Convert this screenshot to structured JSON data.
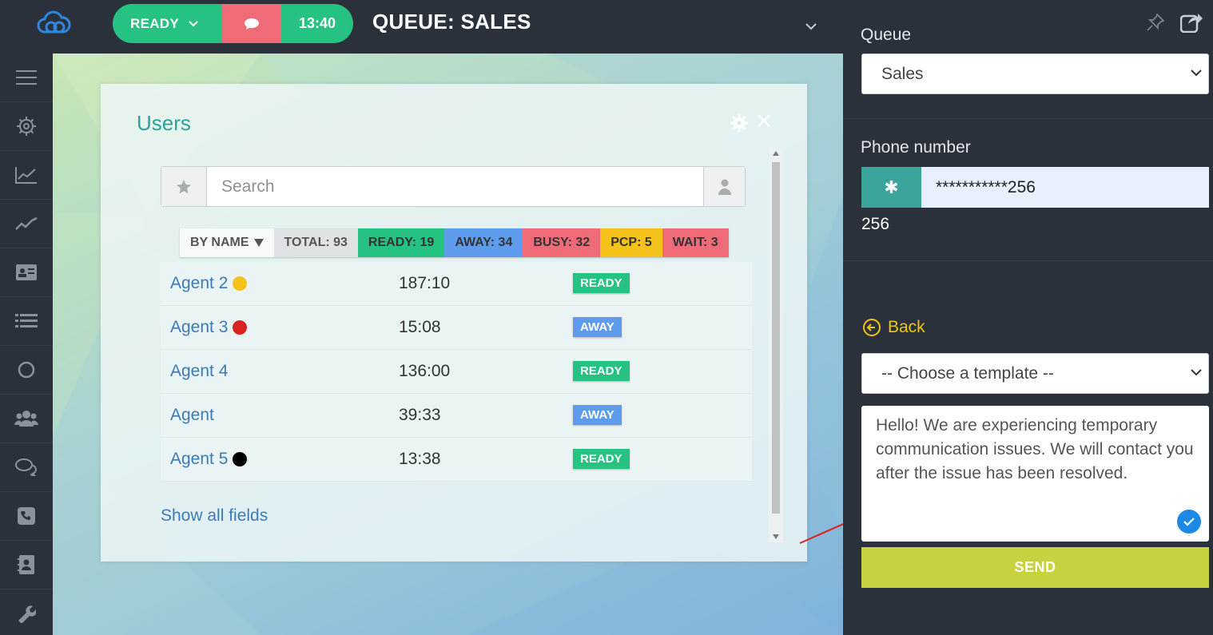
{
  "header": {
    "status_label": "READY",
    "timer": "13:40",
    "queue_title": "QUEUE: SALES"
  },
  "sidebar": {
    "icons": [
      "menu-icon",
      "gear-icon",
      "chart-up-icon",
      "trend-line-icon",
      "id-card-icon",
      "list-icon",
      "circle-icon",
      "users-icon",
      "chat-icon",
      "phone-icon",
      "contacts-icon",
      "wrench-icon"
    ]
  },
  "users_panel": {
    "title": "Users",
    "search_placeholder": "Search",
    "filters": {
      "by_name": "BY NAME",
      "total": "TOTAL: 93",
      "ready": "READY: 19",
      "away": "AWAY: 34",
      "busy": "BUSY: 32",
      "pcp": "PCP: 5",
      "wait": "WAIT: 3"
    },
    "rows": [
      {
        "name": "Agent 2",
        "dot_color": "#f4c21b",
        "time": "187:10",
        "state": "READY"
      },
      {
        "name": "Agent 3",
        "dot_color": "#d9231f",
        "time": "15:08",
        "state": "AWAY"
      },
      {
        "name": "Agent 4",
        "dot_color": "",
        "time": "136:00",
        "state": "READY"
      },
      {
        "name": "Agent",
        "dot_color": "",
        "time": "39:33",
        "state": "AWAY"
      },
      {
        "name": "Agent 5",
        "dot_color": "#000000",
        "time": "13:38",
        "state": "READY"
      }
    ],
    "show_all": "Show all fields"
  },
  "right_panel": {
    "queue_label": "Queue",
    "queue_value": "Sales",
    "phone_label": "Phone number",
    "phone_masked": "***********256",
    "phone_suffix": "256",
    "back_label": "Back",
    "template_value": "-- Choose a template --",
    "message": "Hello! We are experiencing temporary communication issues. We will contact you after the issue has been resolved.",
    "send_label": "SEND"
  },
  "colors": {
    "ready": "#26c281",
    "away": "#5d9cec",
    "busy": "#ef6b78",
    "pcp": "#f4c21b",
    "accent_teal": "#2aa39a",
    "send": "#c8d13f",
    "link_gold": "#f1c40f"
  }
}
